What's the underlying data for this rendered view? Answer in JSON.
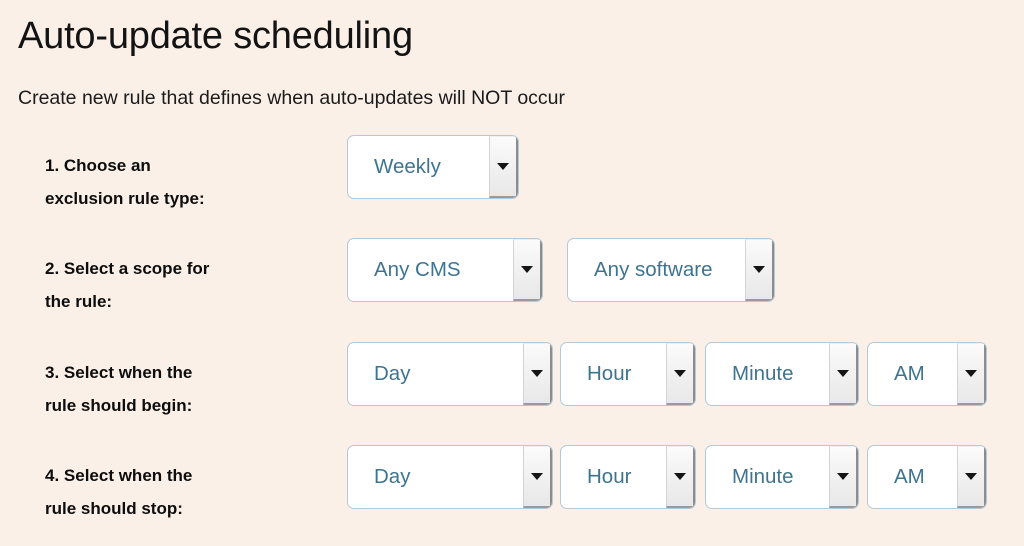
{
  "colors": {
    "background": "#faf0e8",
    "select_text": "#3e7490",
    "select_border": "#b4cad7",
    "label_text": "#0d0d0d",
    "select_face": "#ffffff"
  },
  "header": {
    "title": "Auto-update scheduling",
    "subtitle": "Create new rule that defines when auto-updates will NOT occur"
  },
  "rows": [
    {
      "id": "row-1",
      "label_line1": "1. Choose an",
      "label_line2": "exclusion rule type:",
      "selects": [
        {
          "id": "sel-rule-type",
          "name": "rule-type-select",
          "value": "Weekly"
        }
      ]
    },
    {
      "id": "row-2",
      "label_line1": "2. Select a scope for",
      "label_line2": "the rule:",
      "selects": [
        {
          "id": "sel-scope-cms",
          "name": "scope-cms-select",
          "value": "Any CMS"
        },
        {
          "id": "sel-scope-software",
          "name": "scope-software-select",
          "value": "Any software"
        }
      ]
    },
    {
      "id": "row-3",
      "label_line1": "3. Select when the",
      "label_line2": "rule should begin:",
      "selects": [
        {
          "id": "sel-begin-day",
          "name": "begin-day-select",
          "value": "Day"
        },
        {
          "id": "sel-begin-hour",
          "name": "begin-hour-select",
          "value": "Hour"
        },
        {
          "id": "sel-begin-minute",
          "name": "begin-minute-select",
          "value": "Minute"
        },
        {
          "id": "sel-begin-ampm",
          "name": "begin-ampm-select",
          "value": "AM"
        }
      ]
    },
    {
      "id": "row-4",
      "label_line1": "4. Select when the",
      "label_line2": "rule should stop:",
      "selects": [
        {
          "id": "sel-stop-day",
          "name": "stop-day-select",
          "value": "Day"
        },
        {
          "id": "sel-stop-hour",
          "name": "stop-hour-select",
          "value": "Hour"
        },
        {
          "id": "sel-stop-minute",
          "name": "stop-minute-select",
          "value": "Minute"
        },
        {
          "id": "sel-stop-ampm",
          "name": "stop-ampm-select",
          "value": "AM"
        }
      ]
    }
  ],
  "icons": {
    "dropdown_caret": "chevron-down-icon"
  }
}
